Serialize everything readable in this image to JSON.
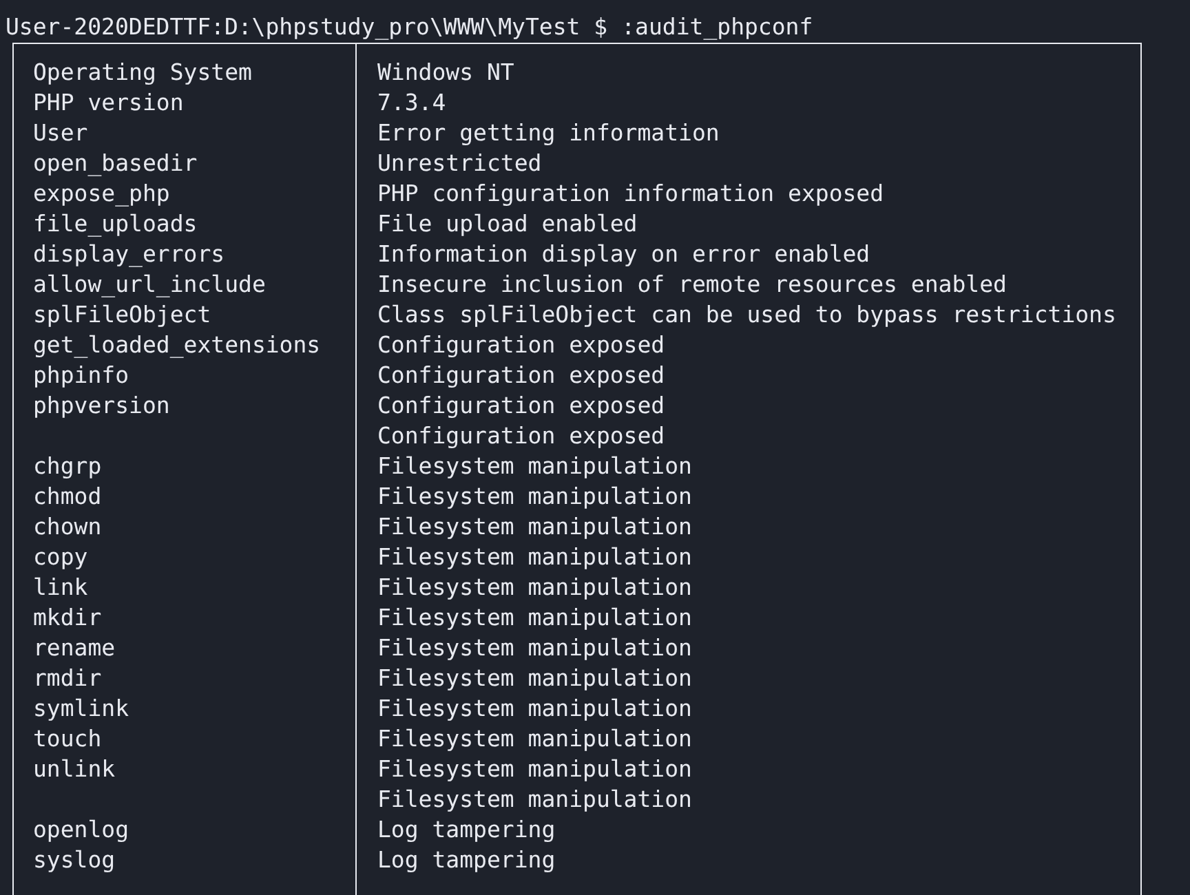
{
  "prompt": {
    "path": "User-2020DEDTTF:D:\\phpstudy_pro\\WWW\\MyTest $",
    "command": ":audit_phpconf"
  },
  "table": {
    "rows": [
      {
        "key": "Operating System",
        "value": "Windows NT"
      },
      {
        "key": "PHP version",
        "value": "7.3.4"
      },
      {
        "key": "User",
        "value": "Error getting information"
      },
      {
        "key": "open_basedir",
        "value": "Unrestricted"
      },
      {
        "key": "expose_php",
        "value": "PHP configuration information exposed"
      },
      {
        "key": "file_uploads",
        "value": "File upload enabled"
      },
      {
        "key": "display_errors",
        "value": "Information display on error enabled"
      },
      {
        "key": "allow_url_include",
        "value": "Insecure inclusion of remote resources enabled"
      },
      {
        "key": "splFileObject",
        "value": "Class splFileObject can be used to bypass restrictions"
      },
      {
        "key": "get_loaded_extensions",
        "value": "Configuration exposed"
      },
      {
        "key": "phpinfo",
        "value": "Configuration exposed"
      },
      {
        "key": "phpversion",
        "value": "Configuration exposed"
      },
      {
        "value": "Configuration exposed"
      },
      {
        "key": "chgrp",
        "value": "Filesystem manipulation"
      },
      {
        "key": "chmod",
        "value": "Filesystem manipulation"
      },
      {
        "key": "chown",
        "value": "Filesystem manipulation"
      },
      {
        "key": "copy",
        "value": "Filesystem manipulation"
      },
      {
        "key": "link",
        "value": "Filesystem manipulation"
      },
      {
        "key": "mkdir",
        "value": "Filesystem manipulation"
      },
      {
        "key": "rename",
        "value": "Filesystem manipulation"
      },
      {
        "key": "rmdir",
        "value": "Filesystem manipulation"
      },
      {
        "key": "symlink",
        "value": "Filesystem manipulation"
      },
      {
        "key": "touch",
        "value": "Filesystem manipulation"
      },
      {
        "key": "unlink",
        "value": "Filesystem manipulation"
      },
      {
        "value": "Filesystem manipulation"
      },
      {
        "key": "openlog",
        "value": "Log tampering"
      },
      {
        "key": "syslog",
        "value": "Log tampering"
      }
    ]
  }
}
